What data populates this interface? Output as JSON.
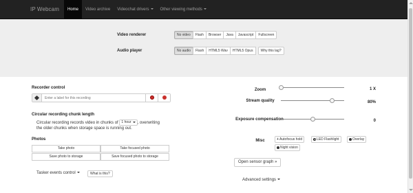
{
  "navbar": {
    "brand": "IP Webcam",
    "items": [
      {
        "label": "Home",
        "active": true,
        "dropdown": false
      },
      {
        "label": "Video archive",
        "active": false,
        "dropdown": false
      },
      {
        "label": "Videochat drivers",
        "active": false,
        "dropdown": true
      },
      {
        "label": "Other viewing methods",
        "active": false,
        "dropdown": true
      }
    ]
  },
  "video_renderer": {
    "label": "Video renderer",
    "options": [
      "No video",
      "Flash",
      "Browser",
      "Java",
      "Javascript",
      "Fullscreen"
    ],
    "selected": "No video"
  },
  "audio_player": {
    "label": "Audio player",
    "options": [
      "No audio",
      "Flash",
      "HTML5 Wav",
      "HTML5 Opus",
      "Why this lag?"
    ],
    "selected": "No audio"
  },
  "recorder": {
    "title": "Recorder control",
    "placeholder": "Enter a label for this recording"
  },
  "circular": {
    "title": "Circular recording chunk length",
    "text_before": "Circular recording records video in chunks of",
    "chunk_value": "1 hour",
    "text_after": ", overwriting",
    "text_line2": "the older chunks when storage space is running out."
  },
  "photos": {
    "title": "Photos",
    "buttons": [
      "Take photo",
      "Take focused photo",
      "Save photo to storage",
      "Save focused photo to storage"
    ]
  },
  "tasker": {
    "label": "Tasker events control",
    "help": "What is this?"
  },
  "sliders": {
    "zoom": {
      "label": "Zoom",
      "value_text": "1 X",
      "level": 0.0
    },
    "quality": {
      "label": "Stream quality",
      "value_text": "80%",
      "level": 0.8
    },
    "exposure": {
      "label": "Exposure compensation",
      "value_text": "0",
      "level": 0.5
    }
  },
  "misc": {
    "label": "Misc",
    "buttons": [
      {
        "label": "Autofocus hold",
        "icon": "plus-icon"
      },
      {
        "label": "LED Flashlight",
        "icon": "half-circle-icon"
      },
      {
        "label": "Overlay",
        "icon": "disc-icon"
      },
      {
        "label": "Night vision",
        "icon": "disc-icon"
      }
    ]
  },
  "sensor": {
    "label": "Open sensor graph »"
  },
  "advanced": {
    "label": "Advanced settings"
  },
  "colors": {
    "navbar_bg": "#222222",
    "navbar_active": "#080808",
    "panel_bg": "#eeeeee",
    "record_red": "#c9302c"
  }
}
